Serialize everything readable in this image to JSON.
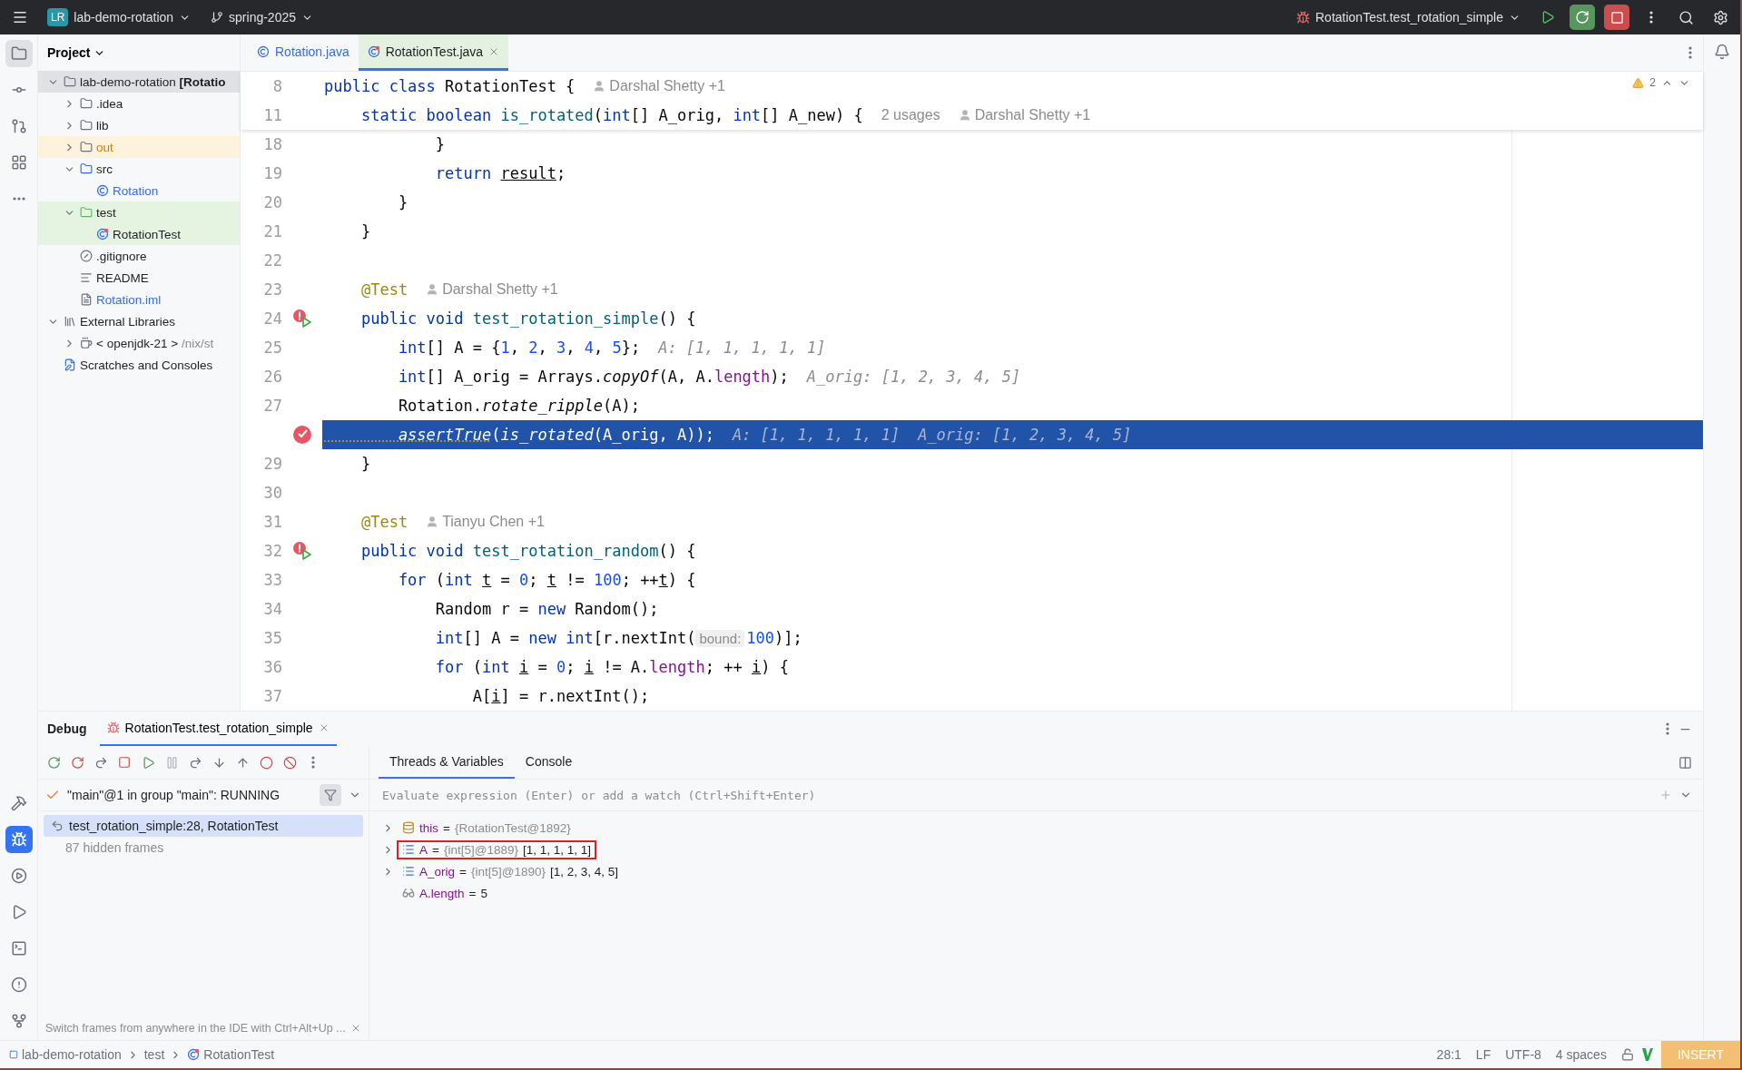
{
  "top_bar": {
    "project_badge": "LR",
    "project": "lab-demo-rotation",
    "branch": "spring-2025",
    "run_config": "RotationTest.test_rotation_simple"
  },
  "left_tools_top": [
    {
      "kind": "folder",
      "selected": true
    },
    {
      "kind": "commit",
      "selected": false
    },
    {
      "kind": "pull-request",
      "selected": false
    },
    {
      "kind": "structure",
      "selected": false
    },
    {
      "kind": "more",
      "selected": false
    }
  ],
  "left_tools_bottom": [
    {
      "kind": "build",
      "selected": false
    },
    {
      "kind": "debug",
      "selected": true
    },
    {
      "kind": "services",
      "selected": false
    },
    {
      "kind": "run",
      "selected": false
    },
    {
      "kind": "terminal",
      "selected": false
    },
    {
      "kind": "problems",
      "selected": false
    },
    {
      "kind": "git",
      "selected": false
    }
  ],
  "project_panel": {
    "title": "Project",
    "tree": [
      {
        "kind": "module",
        "label": "lab-demo-rotation **[Rotatio**",
        "modified": false,
        "excluded": false,
        "expanded": true,
        "selected": true,
        "children": [
          {
            "kind": "folder",
            "label": ".idea",
            "modified": false,
            "excluded": false,
            "expanded": false,
            "selected": false
          },
          {
            "kind": "folder",
            "label": "lib",
            "modified": false,
            "excluded": false,
            "expanded": false,
            "selected": false
          },
          {
            "kind": "folder",
            "label": "out",
            "modified": false,
            "excluded": true,
            "expanded": false,
            "selected": false
          },
          {
            "kind": "source",
            "label": "src",
            "modified": false,
            "excluded": false,
            "expanded": true,
            "selected": false,
            "children": [
              {
                "kind": "class",
                "label": "Rotation",
                "modified": true,
                "excluded": false,
                "selected": false
              }
            ]
          },
          {
            "kind": "test",
            "label": "test",
            "modified": false,
            "excluded": false,
            "expanded": true,
            "selected": false,
            "children": [
              {
                "kind": "test-class",
                "label": "RotationTest",
                "modified": false,
                "excluded": false,
                "selected": false
              }
            ]
          },
          {
            "kind": "ignore-file",
            "label": ".gitignore",
            "modified": false,
            "excluded": false,
            "selected": false
          },
          {
            "kind": "text-file",
            "label": "README",
            "modified": false,
            "excluded": false,
            "selected": false
          },
          {
            "kind": "iml-file",
            "label": "Rotation.iml",
            "modified": true,
            "excluded": false,
            "selected": false
          }
        ]
      },
      {
        "kind": "libraries",
        "label": "External Libraries",
        "modified": false,
        "excluded": false,
        "expanded": true,
        "selected": false,
        "children": [
          {
            "kind": "jdk",
            "label": "< openjdk-21 >",
            "detail": "/nix/st",
            "modified": false,
            "excluded": false,
            "expanded": false,
            "selected": false
          }
        ]
      },
      {
        "kind": "scratches",
        "label": "Scratches and Consoles",
        "modified": false,
        "excluded": false,
        "selected": false
      }
    ]
  },
  "editor": {
    "tabs": [
      {
        "label": "Rotation.java",
        "kind": "class",
        "selected": false
      },
      {
        "label": "RotationTest.java",
        "kind": "test-class",
        "selected": true
      }
    ],
    "warnings": "2",
    "sticky_lines": [
      {
        "n": "8",
        "current": false,
        "code": [
          {
            "text": "public class ",
            "kind": "kw"
          },
          {
            "text": "RotationTest {",
            "kind": "p"
          }
        ],
        "hints": [
          {
            "kind": "author",
            "text": "Darshal Shetty +1"
          }
        ]
      },
      {
        "n": "11",
        "current": false,
        "code": [
          {
            "text": "    static boolean ",
            "kind": "kw"
          },
          {
            "text": "is_rotated",
            "kind": "fn"
          },
          {
            "text": "(",
            "kind": "p"
          },
          {
            "text": "int",
            "kind": "kw"
          },
          {
            "text": "[] A_orig, ",
            "kind": "p"
          },
          {
            "text": "int",
            "kind": "kw"
          },
          {
            "text": "[] A_new) {",
            "kind": "p"
          }
        ],
        "hints": [
          {
            "kind": "usages",
            "text": "2 usages"
          },
          {
            "kind": "author",
            "text": "Darshal Shetty +1"
          }
        ]
      }
    ],
    "lines": [
      {
        "n": "18",
        "current": false,
        "code": [
          {
            "text": "            }",
            "kind": "p"
          }
        ]
      },
      {
        "n": "19",
        "current": false,
        "code": [
          {
            "text": "            return ",
            "kind": "kw"
          },
          {
            "text": "result",
            "kind": "var"
          },
          {
            "text": ";",
            "kind": "p"
          }
        ]
      },
      {
        "n": "20",
        "current": false,
        "code": [
          {
            "text": "        }",
            "kind": "p"
          }
        ]
      },
      {
        "n": "21",
        "current": false,
        "code": [
          {
            "text": "    }",
            "kind": "p"
          }
        ]
      },
      {
        "n": "22",
        "current": false
      },
      {
        "n": "23",
        "current": false,
        "code": [
          {
            "text": "    @Test",
            "kind": "anno"
          }
        ],
        "hints": [
          {
            "kind": "author",
            "text": "Darshal Shetty +1"
          }
        ]
      },
      {
        "n": "24",
        "current": false,
        "kind": "breakpoint-run",
        "code": [
          {
            "text": "    public void ",
            "kind": "kw"
          },
          {
            "text": "test_rotation_simple",
            "kind": "fn"
          },
          {
            "text": "() {",
            "kind": "p"
          }
        ]
      },
      {
        "n": "25",
        "current": false,
        "code": [
          {
            "text": "        int",
            "kind": "kw"
          },
          {
            "text": "[] A = {",
            "kind": "p"
          },
          {
            "text": "1",
            "kind": "num"
          },
          {
            "text": ", ",
            "kind": "p"
          },
          {
            "text": "2",
            "kind": "num"
          },
          {
            "text": ", ",
            "kind": "p"
          },
          {
            "text": "3",
            "kind": "num"
          },
          {
            "text": ", ",
            "kind": "p"
          },
          {
            "text": "4",
            "kind": "num"
          },
          {
            "text": ", ",
            "kind": "p"
          },
          {
            "text": "5",
            "kind": "num"
          },
          {
            "text": "};",
            "kind": "p"
          }
        ],
        "hints": [
          {
            "kind": "inlay",
            "text": "A: [1, 1, 1, 1, 1]"
          }
        ]
      },
      {
        "n": "26",
        "current": false,
        "code": [
          {
            "text": "        int",
            "kind": "kw"
          },
          {
            "text": "[] A_orig = Arrays.",
            "kind": "p"
          },
          {
            "text": "copyOf",
            "kind": "it"
          },
          {
            "text": "(A, A.",
            "kind": "p"
          },
          {
            "text": "length",
            "kind": "fld"
          },
          {
            "text": ");",
            "kind": "p"
          }
        ],
        "hints": [
          {
            "kind": "inlay",
            "text": "A_orig: [1, 2, 3, 4, 5]"
          }
        ]
      },
      {
        "n": "27",
        "current": false,
        "code": [
          {
            "text": "        Rotation.",
            "kind": "p"
          },
          {
            "text": "rotate_ripple",
            "kind": "it"
          },
          {
            "text": "(A);",
            "kind": "p"
          }
        ]
      },
      {
        "current": true,
        "kind": "breakpoint-hit",
        "code": [
          {
            "text": "        assertTrue",
            "kind": "warn"
          },
          {
            "text": "(",
            "kind": "p"
          },
          {
            "text": "is_rotated",
            "kind": "it"
          },
          {
            "text": "(A_orig, A));",
            "kind": "p"
          }
        ],
        "hints": [
          {
            "kind": "inlay",
            "text": "A: [1, 1, 1, 1, 1]"
          },
          {
            "kind": "inlay",
            "text": "A_orig: [1, 2, 3, 4, 5]"
          }
        ]
      },
      {
        "n": "29",
        "current": false,
        "code": [
          {
            "text": "    }",
            "kind": "p"
          }
        ]
      },
      {
        "n": "30",
        "current": false
      },
      {
        "n": "31",
        "current": false,
        "code": [
          {
            "text": "    @Test",
            "kind": "anno"
          }
        ],
        "hints": [
          {
            "kind": "author",
            "text": "Tianyu Chen +1"
          }
        ]
      },
      {
        "n": "32",
        "current": false,
        "kind": "breakpoint-run",
        "code": [
          {
            "text": "    public void ",
            "kind": "kw"
          },
          {
            "text": "test_rotation_random",
            "kind": "fn"
          },
          {
            "text": "() {",
            "kind": "p"
          }
        ]
      },
      {
        "n": "33",
        "current": false,
        "code": [
          {
            "text": "        for ",
            "kind": "kw"
          },
          {
            "text": "(",
            "kind": "p"
          },
          {
            "text": "int ",
            "kind": "kw"
          },
          {
            "text": "t",
            "kind": "var"
          },
          {
            "text": " = ",
            "kind": "p"
          },
          {
            "text": "0",
            "kind": "num"
          },
          {
            "text": "; ",
            "kind": "p"
          },
          {
            "text": "t",
            "kind": "var"
          },
          {
            "text": " != ",
            "kind": "p"
          },
          {
            "text": "100",
            "kind": "num"
          },
          {
            "text": "; ++",
            "kind": "p"
          },
          {
            "text": "t",
            "kind": "var"
          },
          {
            "text": ") {",
            "kind": "p"
          }
        ]
      },
      {
        "n": "34",
        "current": false,
        "code": [
          {
            "text": "            Random r = ",
            "kind": "p"
          },
          {
            "text": "new",
            "kind": "kw"
          },
          {
            "text": " Random();",
            "kind": "p"
          }
        ]
      },
      {
        "n": "35",
        "current": false,
        "code": [
          {
            "text": "            int",
            "kind": "kw"
          },
          {
            "text": "[] A = ",
            "kind": "p"
          },
          {
            "text": "new int",
            "kind": "kw"
          },
          {
            "text": "[r.nextInt(",
            "kind": "p"
          },
          {
            "text": "bound:",
            "kind": "prm"
          },
          {
            "text": "100",
            "kind": "num"
          },
          {
            "text": ")];",
            "kind": "p"
          }
        ]
      },
      {
        "n": "36",
        "current": false,
        "code": [
          {
            "text": "            for ",
            "kind": "kw"
          },
          {
            "text": "(",
            "kind": "p"
          },
          {
            "text": "int ",
            "kind": "kw"
          },
          {
            "text": "i",
            "kind": "var"
          },
          {
            "text": " = ",
            "kind": "p"
          },
          {
            "text": "0",
            "kind": "num"
          },
          {
            "text": "; ",
            "kind": "p"
          },
          {
            "text": "i",
            "kind": "var"
          },
          {
            "text": " != A.",
            "kind": "p"
          },
          {
            "text": "length",
            "kind": "fld"
          },
          {
            "text": "; ++ ",
            "kind": "p"
          },
          {
            "text": "i",
            "kind": "var"
          },
          {
            "text": ") {",
            "kind": "p"
          }
        ]
      },
      {
        "n": "37",
        "current": false,
        "code": [
          {
            "text": "                A[",
            "kind": "p"
          },
          {
            "text": "i",
            "kind": "var"
          },
          {
            "text": "] = r.nextInt();",
            "kind": "p"
          }
        ]
      }
    ]
  },
  "debug": {
    "title": "Debug",
    "session": "RotationTest.test_rotation_simple",
    "tabs": [
      {
        "label": "Threads & Variables",
        "selected": true
      },
      {
        "label": "Console",
        "selected": false
      }
    ],
    "thread": "\"main\"@1 in group \"main\": RUNNING",
    "frames": [
      {
        "label": "test_rotation_simple:28, RotationTest",
        "selected": true
      }
    ],
    "hidden_frames": "87 hidden frames",
    "tip": "Switch frames from anywhere in the IDE with Ctrl+Alt+Up ...",
    "evaluate": {
      "placeholder": "Evaluate expression (Enter) or add a watch (Ctrl+Shift+Enter)"
    },
    "variables": [
      {
        "kind": "object",
        "name": "this",
        "eq": "=",
        "ref": "{RotationTest@1892}",
        "expandable": true,
        "highlighted": false
      },
      {
        "kind": "array",
        "name": "A",
        "eq": "=",
        "ref": "{int[5]@1889}",
        "value": "[1, 1, 1, 1, 1]",
        "expandable": true,
        "highlighted": true
      },
      {
        "kind": "array",
        "name": "A_orig",
        "eq": "=",
        "ref": "{int[5]@1890}",
        "value": "[1, 2, 3, 4, 5]",
        "expandable": true,
        "highlighted": false
      },
      {
        "kind": "watch",
        "name": "A.length",
        "eq": "=",
        "value": "5",
        "expandable": false,
        "highlighted": false
      }
    ]
  },
  "status_bar": {
    "breadcrumbs": [
      {
        "kind": "module",
        "label": "lab-demo-rotation"
      },
      {
        "kind": "folder",
        "label": "test"
      },
      {
        "kind": "test-class",
        "label": "RotationTest"
      }
    ],
    "position": "28:1",
    "line_ending": "LF",
    "encoding": "UTF-8",
    "indent": "4 spaces",
    "mode": "INSERT"
  }
}
